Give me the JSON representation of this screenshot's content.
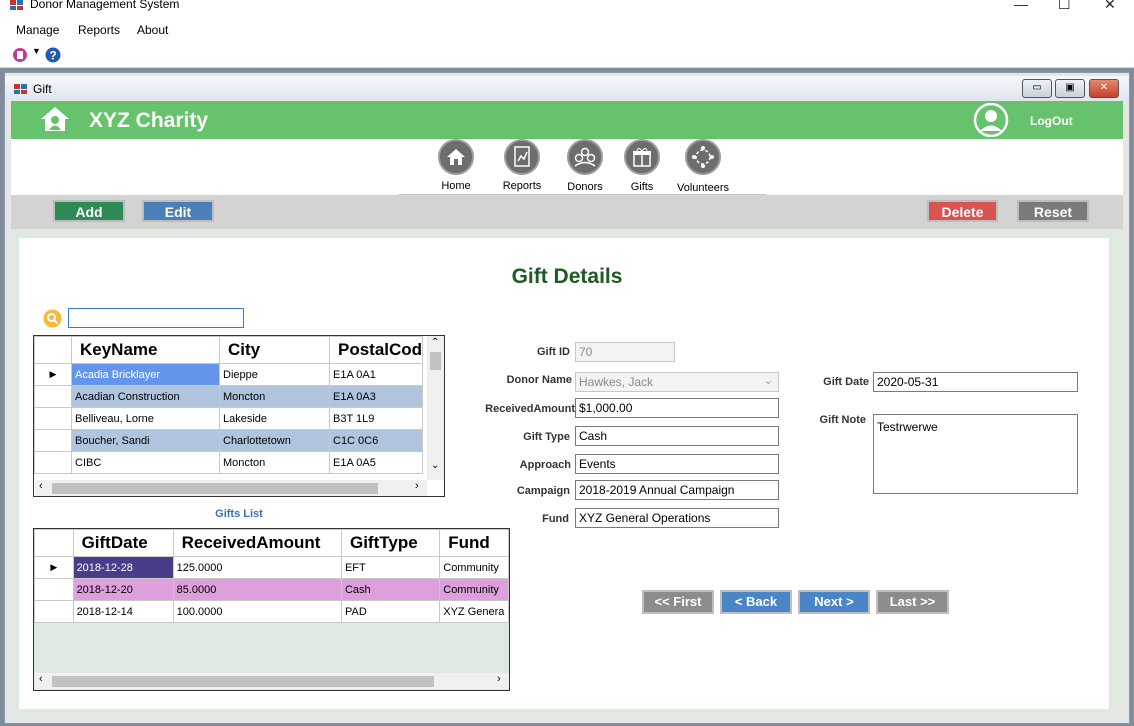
{
  "app": {
    "title": "Donor Management System",
    "menu": [
      "Manage",
      "Reports",
      "About"
    ],
    "window_controls": [
      "—",
      "☐",
      "✕"
    ]
  },
  "child_window": {
    "title": "Gift",
    "controls": [
      "▭",
      "▣",
      "✕"
    ]
  },
  "banner": {
    "brand": "XYZ Charity",
    "logout": "LogOut"
  },
  "nav": {
    "items": [
      {
        "label": "Home",
        "icon": "home-icon"
      },
      {
        "label": "Reports",
        "icon": "reports-icon"
      },
      {
        "label": "Donors",
        "icon": "donors-icon"
      },
      {
        "label": "Gifts",
        "icon": "gifts-icon"
      },
      {
        "label": "Volunteers",
        "icon": "volunteers-icon"
      }
    ]
  },
  "actions": {
    "add": "Add",
    "edit": "Edit",
    "delete": "Delete",
    "reset": "Reset"
  },
  "page_title": "Gift Details",
  "search": {
    "value": ""
  },
  "donors_grid": {
    "columns": [
      "KeyName",
      "City",
      "PostalCod"
    ],
    "rows": [
      [
        "Acadia Bricklayer",
        "Dieppe",
        "E1A 0A1"
      ],
      [
        "Acadian Construction",
        "Moncton",
        "E1A 0A3"
      ],
      [
        "Belliveau, Lorne",
        "Lakeside",
        "B3T 1L9"
      ],
      [
        "Boucher, Sandi",
        "Charlottetown",
        "C1C 0C6"
      ],
      [
        "CIBC",
        "Moncton",
        "E1A 0A5"
      ]
    ]
  },
  "gifts_list_label": "Gifts List",
  "gifts_grid": {
    "columns": [
      "GiftDate",
      "ReceivedAmount",
      "GiftType",
      "Fund"
    ],
    "rows": [
      [
        "2018-12-28",
        "125.0000",
        "EFT",
        "Community"
      ],
      [
        "2018-12-20",
        "85.0000",
        "Cash",
        "Community"
      ],
      [
        "2018-12-14",
        "100.0000",
        "PAD",
        "XYZ Genera"
      ]
    ]
  },
  "form": {
    "gift_id": {
      "label": "Gift ID",
      "value": "70"
    },
    "donor_name": {
      "label": "Donor Name",
      "value": "Hawkes, Jack"
    },
    "received_amount": {
      "label": "ReceivedAmount",
      "value": "$1,000.00"
    },
    "gift_type": {
      "label": "Gift Type",
      "value": "Cash"
    },
    "approach": {
      "label": "Approach",
      "value": "Events"
    },
    "campaign": {
      "label": "Campaign",
      "value": "2018-2019 Annual Campaign"
    },
    "fund": {
      "label": "Fund",
      "value": "XYZ General Operations"
    },
    "gift_date": {
      "label": "Gift Date",
      "value": "2020-05-31"
    },
    "gift_note": {
      "label": "Gift Note",
      "value": "Testrwerwe"
    }
  },
  "pager": {
    "first": "<< First",
    "back": "< Back",
    "next": "Next >",
    "last": "Last >>"
  },
  "colors": {
    "banner_green": "#66c26c",
    "add": "#2e8b57",
    "edit": "#4a7fb8",
    "delete": "#d9534f",
    "reset": "#7a7a7a",
    "pager_gray": "#8c8c8c",
    "pager_blue": "#4a86c5",
    "row_selected": "#6495ed",
    "row_alt": "#b0c4de",
    "gift_selected": "#483d8b",
    "gift_alt": "#dda0dd"
  }
}
